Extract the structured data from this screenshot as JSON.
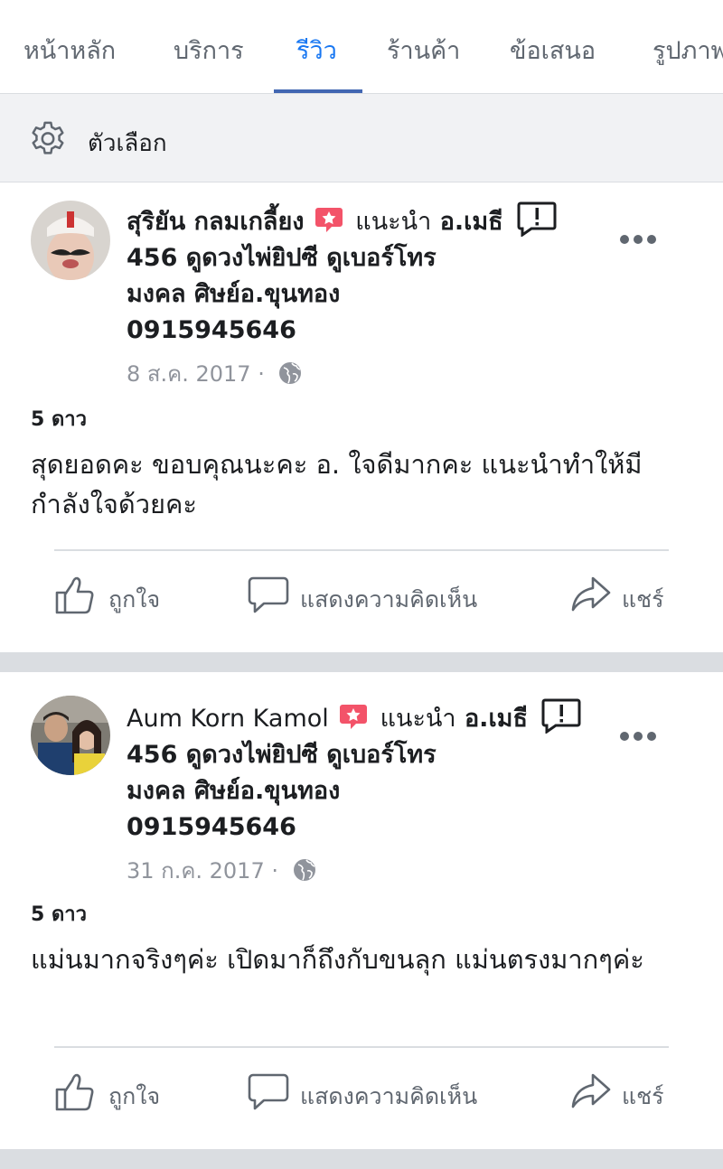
{
  "tabs": [
    {
      "label": "หน้าหลัก",
      "active": false
    },
    {
      "label": "บริการ",
      "active": false
    },
    {
      "label": "รีวิว",
      "active": true
    },
    {
      "label": "ร้านค้า",
      "active": false
    },
    {
      "label": "ข้อเสนอ",
      "active": false
    },
    {
      "label": "รูปภาพ",
      "active": false
    }
  ],
  "options": {
    "label": "ตัวเลือก",
    "icon": "gear-icon"
  },
  "colors": {
    "accent": "#1877f2",
    "underline": "#4267b2",
    "badge": "#f35369",
    "muted": "#606770"
  },
  "reviews": [
    {
      "author": "สุริยัน กลมเกลี้ยง",
      "recommends": "แนะนำ",
      "page_name_1": "อ.เมธี",
      "page_name_2": "456 ดูดวงไพ่ยิปซี ดูเบอร์โทร",
      "page_name_3": "มงคล ศิษย์อ.ขุนทอง",
      "page_name_4": "0915945646",
      "date": "8 ส.ค. 2017 ·",
      "rating": "5 ดาว",
      "body": "สุดยอดคะ ขอบคุณนะคะ อ. ใจดีมากคะ แนะนำทำให้มีกำลังใจด้วยคะ"
    },
    {
      "author": "Aum Korn Kamol",
      "recommends": "แนะนำ",
      "page_name_1": "อ.เมธี",
      "page_name_2": "456 ดูดวงไพ่ยิปซี ดูเบอร์โทร",
      "page_name_3": "มงคล ศิษย์อ.ขุนทอง",
      "page_name_4": "0915945646",
      "date": "31 ก.ค. 2017 ·",
      "rating": "5 ดาว",
      "body": "แม่นมากจริงๆค่ะ  เปิดมาก็ถึงกับขนลุก  แม่นตรงมากๆค่ะ"
    }
  ],
  "actions": {
    "like": "ถูกใจ",
    "comment": "แสดงความคิดเห็น",
    "share": "แชร์"
  }
}
